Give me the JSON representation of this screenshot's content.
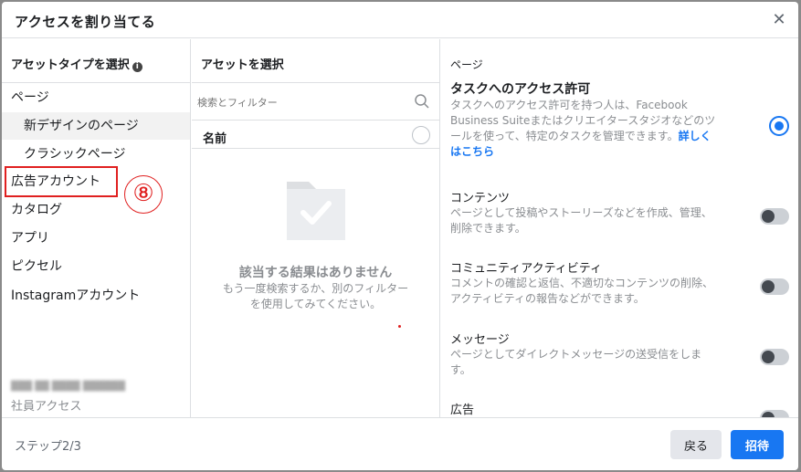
{
  "dialog": {
    "title": "アクセスを割り当てる",
    "close_icon": "close-icon"
  },
  "asset_types": {
    "header": "アセットタイプを選択",
    "items": [
      {
        "label": "ページ"
      },
      {
        "label": "新デザインのページ",
        "selected": true
      },
      {
        "label": "クラシックページ"
      },
      {
        "label": "広告アカウント",
        "highlighted": true
      },
      {
        "label": "カタログ"
      },
      {
        "label": "アプリ"
      },
      {
        "label": "ピクセル"
      },
      {
        "label": "Instagramアカウント"
      }
    ],
    "annotation_marker": "⑧",
    "staff_access": "社員アクセス"
  },
  "assets": {
    "header": "アセットを選択",
    "search_placeholder": "検索とフィルター",
    "name_label": "名前",
    "empty_title": "該当する結果はありません",
    "empty_line1": "もう一度検索するか、別のフィルター",
    "empty_line2": "を使用してみてください。"
  },
  "permissions": {
    "section_label": "ページ",
    "tasks": [
      {
        "title": "タスクへのアクセス許可",
        "desc_line1": "タスクへのアクセス許可を持つ人は、Facebook",
        "desc_line2": "Business Suiteまたはクリエイタースタジオなどのツ",
        "desc_line3": "ールを使って、特定のタスクを管理できます。",
        "link": "詳しく",
        "link2": "はこちら",
        "control": "radio",
        "state": "on"
      },
      {
        "title": "コンテンツ",
        "desc_line1": "ページとして投稿やストーリーズなどを作成、管理、",
        "desc_line2": "削除できます。",
        "control": "toggle",
        "state": "off"
      },
      {
        "title": "コミュニティアクティビティ",
        "desc_line1": "コメントの確認と返信、不適切なコンテンツの削除、",
        "desc_line2": "アクティビティの報告などができます。",
        "control": "toggle",
        "state": "off"
      },
      {
        "title": "メッセージ",
        "desc_line1": "ページとしてダイレクトメッセージの送受信をしま",
        "desc_line2": "す。",
        "control": "toggle",
        "state": "off"
      },
      {
        "title": "広告",
        "control": "toggle",
        "state": "off"
      }
    ]
  },
  "footer": {
    "step": "ステップ2/3",
    "back_label": "戻る",
    "invite_label": "招待"
  },
  "colors": {
    "accent": "#1877f2",
    "annotation": "#e02020"
  }
}
